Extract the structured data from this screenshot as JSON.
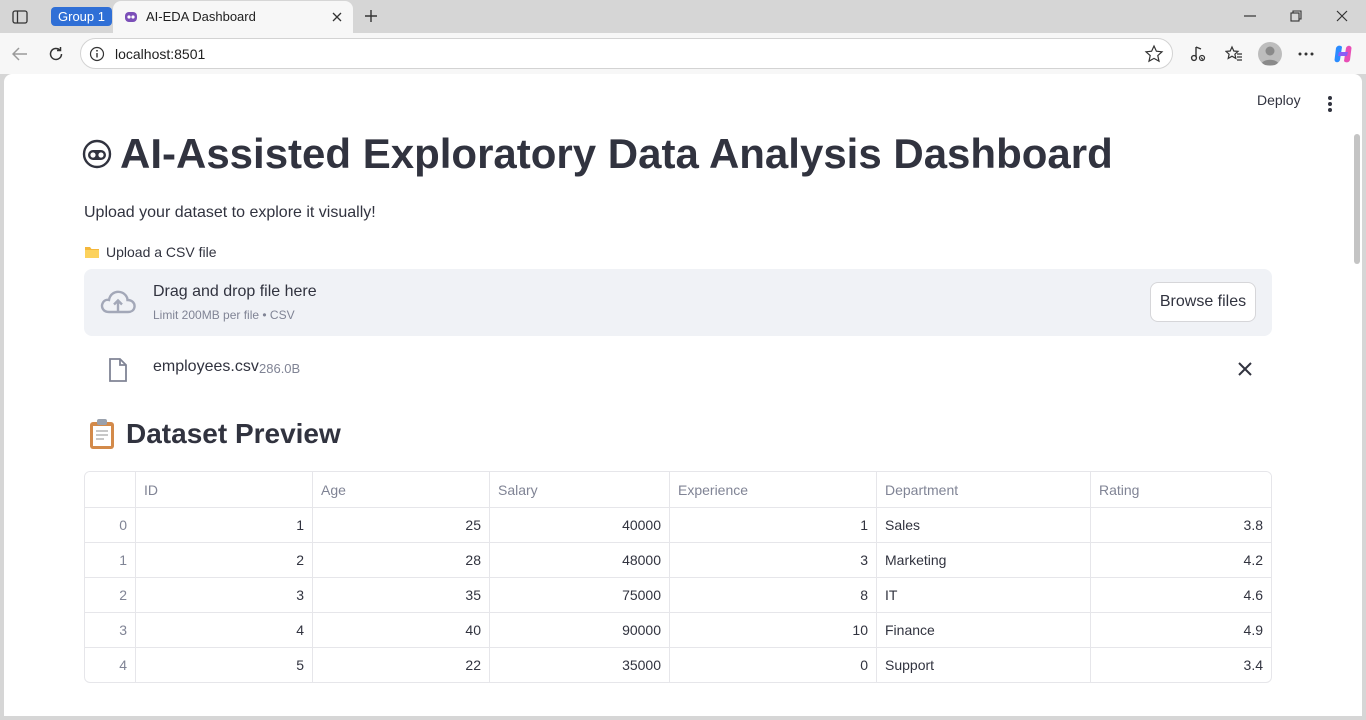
{
  "browser": {
    "group_label": "Group 1",
    "tab_title": "AI-EDA Dashboard",
    "url": "localhost:8501"
  },
  "app": {
    "deploy_label": "Deploy",
    "title": "AI-Assisted Exploratory Data Analysis Dashboard",
    "title_icon": "robot-face-icon",
    "intro": "Upload your dataset to explore it visually!"
  },
  "uploader": {
    "label": "Upload a CSV file",
    "label_icon": "folder-icon",
    "drop_title": "Drag and drop file here",
    "drop_sub": "Limit 200MB per file • CSV",
    "browse_label": "Browse files",
    "file_name": "employees.csv",
    "file_size": "286.0B"
  },
  "preview": {
    "title": "Dataset Preview",
    "title_icon": "clipboard-icon",
    "columns": [
      "",
      "ID",
      "Age",
      "Salary",
      "Experience",
      "Department",
      "Rating"
    ],
    "rows": [
      [
        "0",
        "1",
        "25",
        "40000",
        "1",
        "Sales",
        "3.8"
      ],
      [
        "1",
        "2",
        "28",
        "48000",
        "3",
        "Marketing",
        "4.2"
      ],
      [
        "2",
        "3",
        "35",
        "75000",
        "8",
        "IT",
        "4.6"
      ],
      [
        "3",
        "4",
        "40",
        "90000",
        "10",
        "Finance",
        "4.9"
      ],
      [
        "4",
        "5",
        "22",
        "35000",
        "0",
        "Support",
        "3.4"
      ]
    ]
  },
  "colors": {
    "group_chip": "#2f6fd6",
    "text": "#31333f",
    "muted": "#808495",
    "dropzone_bg": "#f0f2f6"
  }
}
